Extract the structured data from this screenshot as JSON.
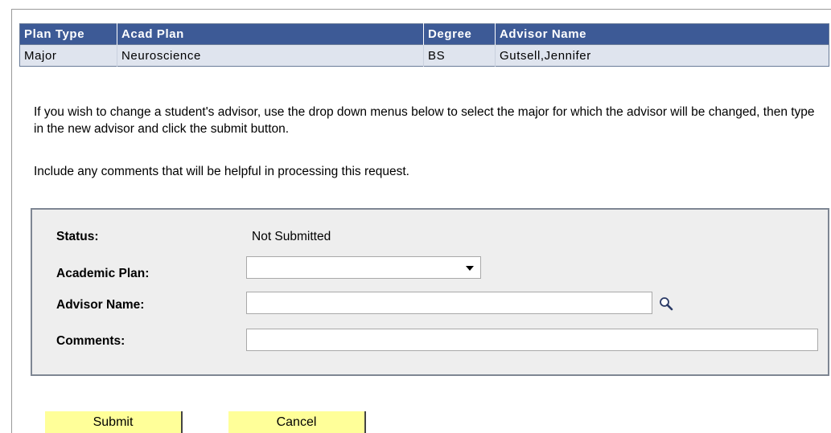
{
  "plans_table": {
    "headers": [
      "Plan Type",
      "Acad Plan",
      "Degree",
      "Advisor Name"
    ],
    "rows": [
      [
        "Major",
        "Neuroscience",
        "BS",
        "Gutsell,Jennifer"
      ]
    ]
  },
  "instructions": {
    "paragraph1": "If you wish to change a student's advisor, use the drop down menus below to select the major for which the advisor will be changed, then type in the new advisor and click the submit button.",
    "paragraph2": "Include any comments that will be helpful in processing this request."
  },
  "form": {
    "status_label": "Status:",
    "status_value": "Not Submitted",
    "academic_plan_label": "Academic Plan:",
    "academic_plan_value": "",
    "advisor_name_label": "Advisor Name:",
    "advisor_name_value": "",
    "comments_label": "Comments:",
    "comments_value": ""
  },
  "buttons": {
    "submit_label": "Submit",
    "cancel_label": "Cancel"
  },
  "icons": {
    "lookup": "magnifying-glass-icon",
    "dropdown": "triangle-down-icon"
  },
  "colors": {
    "header_bg": "#3d5a96",
    "row_bg": "#dfe4ee",
    "form_bg": "#eeeeee",
    "button_bg": "#ffff99"
  }
}
